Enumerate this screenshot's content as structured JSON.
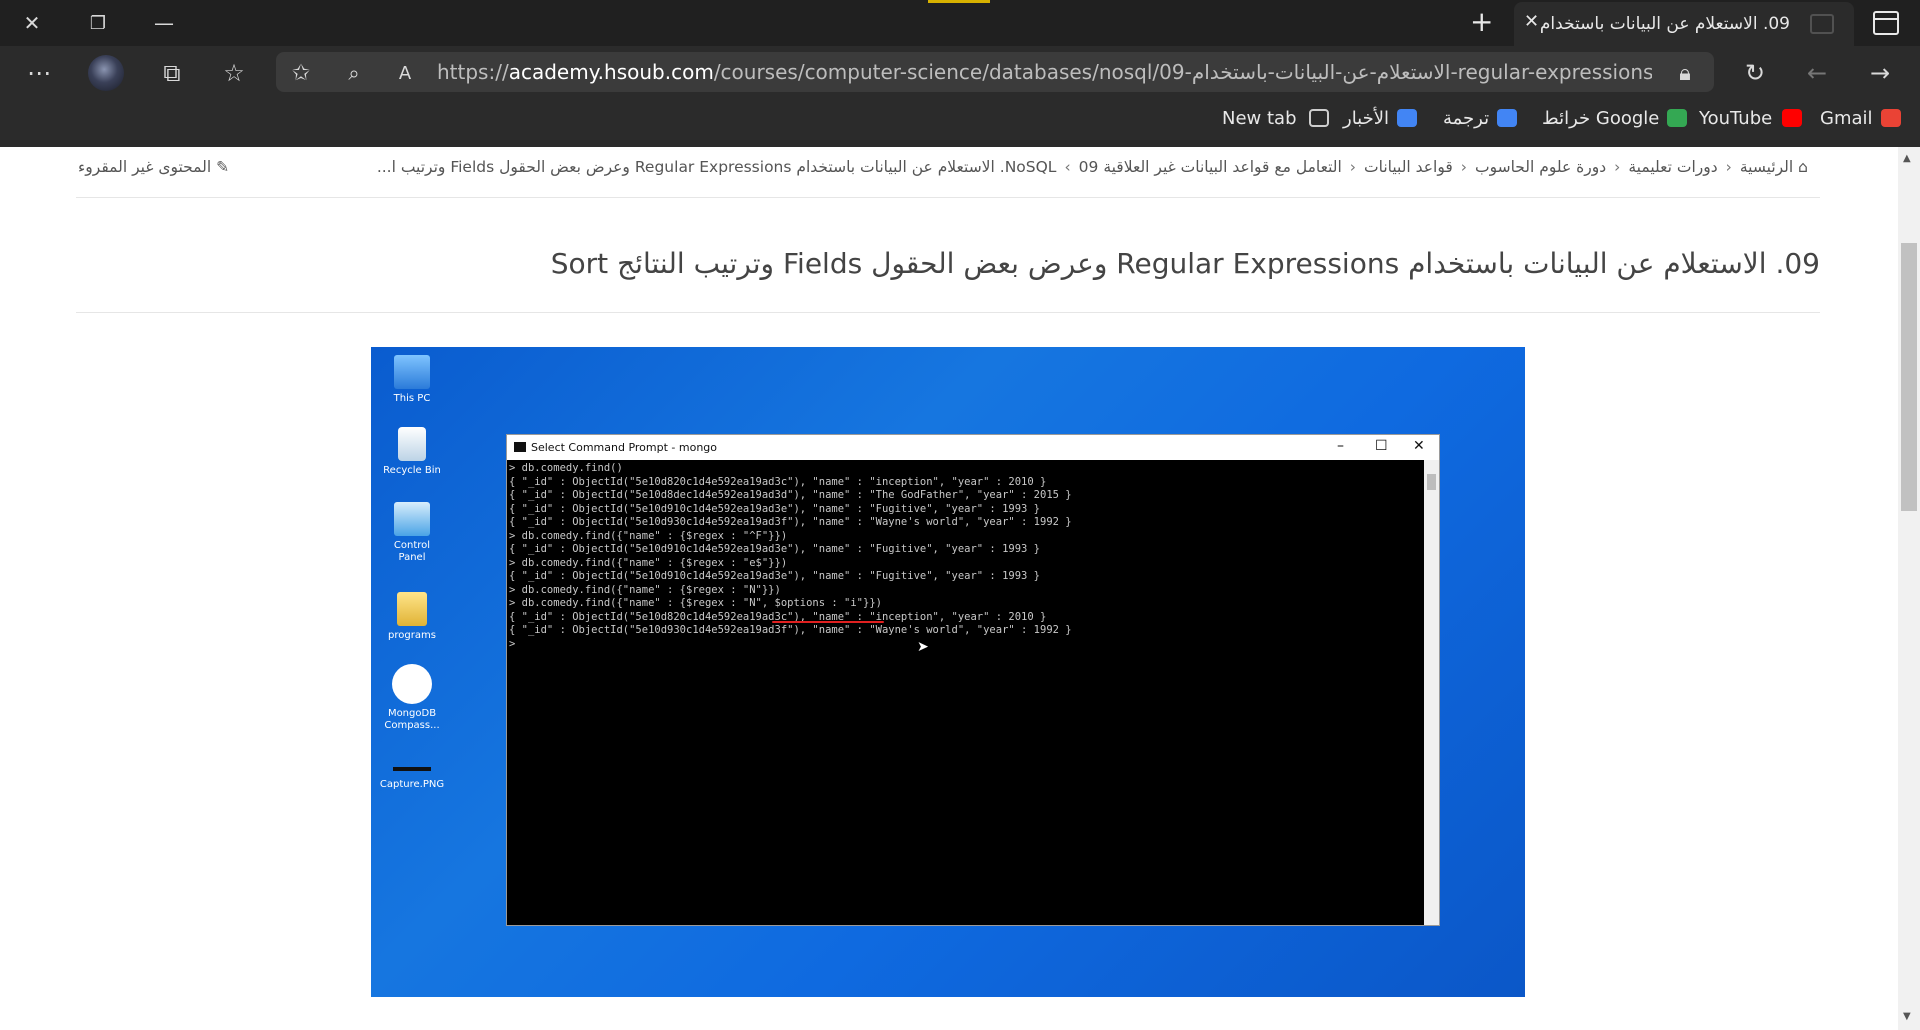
{
  "browser": {
    "tab": {
      "title": "09. الاستعلام عن البيانات باستخدام",
      "close_label": "✕"
    },
    "window_controls": {
      "close": "✕",
      "restore": "❐",
      "minimize": "—"
    },
    "new_tab_label": "+",
    "address": {
      "domain": "academy.hsoub.com",
      "prefix": "https://",
      "path": "/courses/computer-science/databases/nosql/09-الاستعلام-عن-البيانات-باستخدام-regular-expressions-وعرض-بع..."
    },
    "bookmarks": [
      {
        "label": "Gmail",
        "icon": "gmail-icon",
        "color": "#ea4335"
      },
      {
        "label": "YouTube",
        "icon": "youtube-icon",
        "color": "#ff0000"
      },
      {
        "label": "خرائط Google",
        "icon": "maps-icon",
        "color": "#34a853"
      },
      {
        "label": "ترجمة",
        "icon": "translate-icon",
        "color": "#4285f4"
      },
      {
        "label": "الأخبار",
        "icon": "news-icon",
        "color": "#4285f4"
      },
      {
        "label": "New tab",
        "icon": "newtab-icon",
        "color": "#cfcfcf"
      }
    ]
  },
  "page": {
    "breadcrumb": [
      "الرئيسية",
      "دورات تعليمية",
      "دورة علوم الحاسوب",
      "قواعد البيانات",
      "التعامل مع قواعد البيانات غير العلاقية NoSQL",
      "09. الاستعلام عن البيانات باستخدام Regular Expressions وعرض بعض الحقول Fields وترتيب ا..."
    ],
    "unread_label": "المحتوى غير المقروء",
    "title": "09. الاستعلام عن البيانات باستخدام Regular Expressions وعرض بعض الحقول Fields وترتيب النتائج Sort"
  },
  "video": {
    "desktop_icons": [
      "This PC",
      "Recycle Bin",
      "Control Panel",
      "programs",
      "MongoDB Compass...",
      "Capture.PNG"
    ],
    "window_title": "Select Command Prompt - mongo",
    "console": "> db.comedy.find()\n{ \"_id\" : ObjectId(\"5e10d820c1d4e592ea19ad3c\"), \"name\" : \"inception\", \"year\" : 2010 }\n{ \"_id\" : ObjectId(\"5e10d8dec1d4e592ea19ad3d\"), \"name\" : \"The GodFather\", \"year\" : 2015 }\n{ \"_id\" : ObjectId(\"5e10d910c1d4e592ea19ad3e\"), \"name\" : \"Fugitive\", \"year\" : 1993 }\n{ \"_id\" : ObjectId(\"5e10d930c1d4e592ea19ad3f\"), \"name\" : \"Wayne's world\", \"year\" : 1992 }\n> db.comedy.find({\"name\" : {$regex : \"^F\"}})\n{ \"_id\" : ObjectId(\"5e10d910c1d4e592ea19ad3e\"), \"name\" : \"Fugitive\", \"year\" : 1993 }\n> db.comedy.find({\"name\" : {$regex : \"e$\"}})\n{ \"_id\" : ObjectId(\"5e10d910c1d4e592ea19ad3e\"), \"name\" : \"Fugitive\", \"year\" : 1993 }\n> db.comedy.find({\"name\" : {$regex : \"N\"}})\n> db.comedy.find({\"name\" : {$regex : \"N\", $options : \"i\"}})\n{ \"_id\" : ObjectId(\"5e10d820c1d4e592ea19ad3c\"), \"name\" : \"inception\", \"year\" : 2010 }\n{ \"_id\" : ObjectId(\"5e10d930c1d4e592ea19ad3f\"), \"name\" : \"Wayne's world\", \"year\" : 1992 }\n>"
  }
}
